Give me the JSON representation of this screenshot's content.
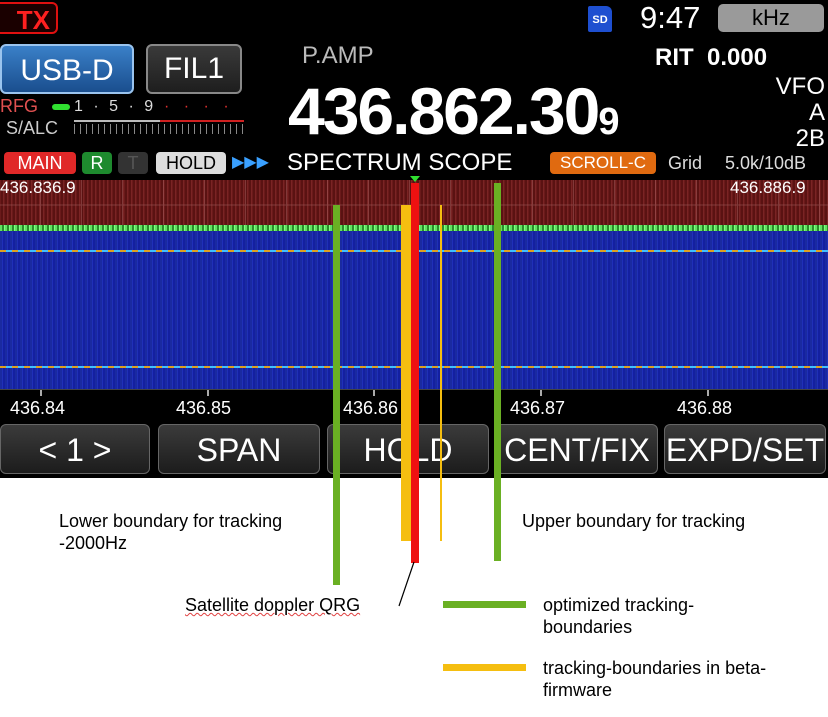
{
  "status": {
    "tx": "TX",
    "sd": "SD",
    "clock": "9:47",
    "unit": "kHz"
  },
  "mode": {
    "mode_button": "USB-D",
    "filter_button": "FIL1",
    "pamp": "P.AMP",
    "rit_label": "RIT",
    "rit_value": "0.000",
    "vfo_line1": "VFO A",
    "vfo_line2": "2B",
    "frequency_main": "436.862.30",
    "frequency_small": "9"
  },
  "meter": {
    "rfg": "RFG",
    "salc": "S/ALC",
    "scale_white": "1 · 5 · 9",
    "scale_red": "· · · ·"
  },
  "scope_bar": {
    "main": "MAIN",
    "r": "R",
    "t": "T",
    "hold": "HOLD",
    "arrows": "▶▶▶",
    "title": "SPECTRUM SCOPE",
    "scroll": "SCROLL-C",
    "grid": "Grid",
    "span": "5.0k/10dB"
  },
  "scope": {
    "edge_left": "436.836.9",
    "edge_right": "436.886.9",
    "axis_labels": [
      "436.84",
      "436.85",
      "436.86",
      "436.87",
      "436.88"
    ]
  },
  "softkeys": [
    "< 1 >",
    "SPAN",
    "HOLD",
    "CENT/FIX",
    "EXPD/SET"
  ],
  "annotations": {
    "lower_boundary_line1": "Lower boundary for tracking",
    "lower_boundary_line2": "-2000Hz",
    "upper_boundary": "Upper boundary for tracking",
    "doppler": "Satellite doppler QRG",
    "legend_green_line1": "optimized tracking-",
    "legend_green_line2": "boundaries",
    "legend_yellow_line1": "tracking-boundaries in beta-",
    "legend_yellow_line2": "firmware"
  },
  "colors": {
    "green_boundary": "#6ab023",
    "yellow_boundary": "#f5be10",
    "red_doppler": "#ee1111"
  }
}
